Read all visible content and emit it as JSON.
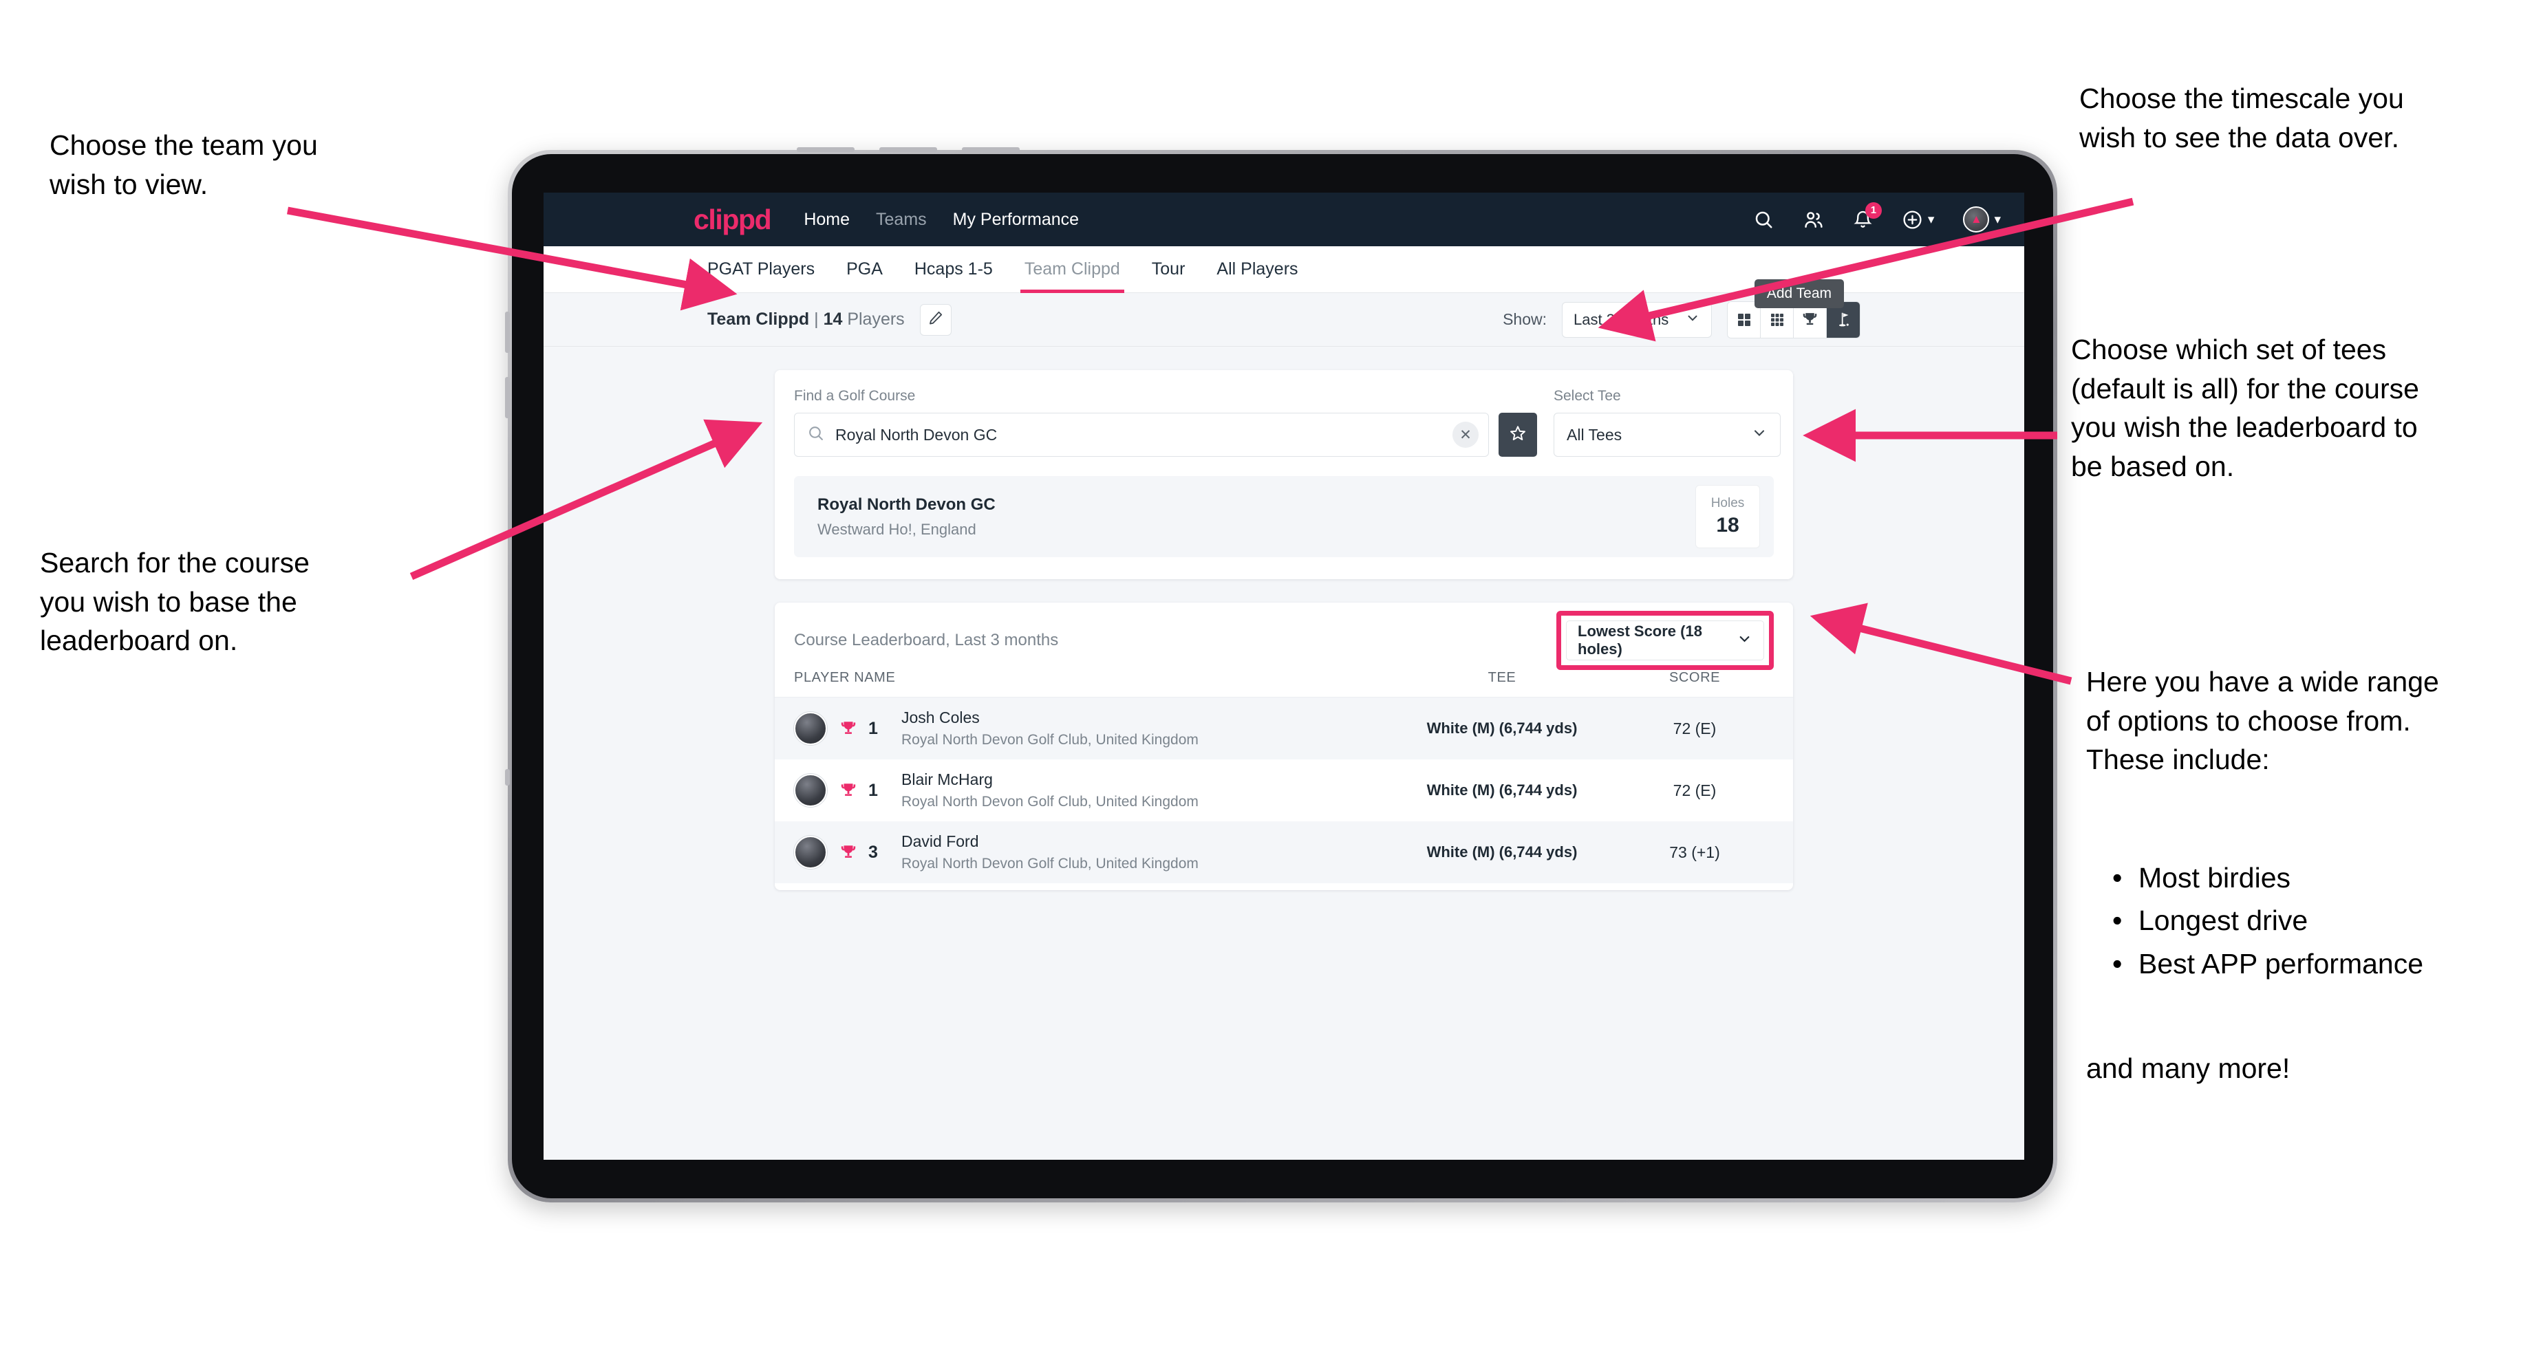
{
  "annotations": {
    "left_top": "Choose the team you\nwish to view.",
    "left_bottom": "Search for the course\nyou wish to base the\nleaderboard on.",
    "right_top": "Choose the timescale you\nwish to see the data over.",
    "right_mid": "Choose which set of tees\n(default is all) for the course\nyou wish the leaderboard to\nbe based on.",
    "right_bottom_intro": "Here you have a wide range\nof options to choose from.\nThese include:",
    "right_bottom_bullets": [
      "Most birdies",
      "Longest drive",
      "Best APP performance"
    ],
    "right_bottom_tail": "and many more!"
  },
  "app": {
    "brand": "clippd",
    "nav": [
      {
        "label": "Home",
        "active": true
      },
      {
        "label": "Teams",
        "active": false
      },
      {
        "label": "My Performance",
        "active": true
      }
    ],
    "header_icons": {
      "search": "search-icon",
      "people": "people-icon",
      "notifications": "bell-icon",
      "notification_count": "1",
      "add": "plus-circle-icon",
      "profile": "avatar-icon"
    },
    "tabs": [
      {
        "label": "PGAT Players",
        "active": false,
        "muted": false
      },
      {
        "label": "PGA",
        "active": false,
        "muted": false
      },
      {
        "label": "Hcaps 1-5",
        "active": false,
        "muted": false
      },
      {
        "label": "Team Clippd",
        "active": true,
        "muted": true
      },
      {
        "label": "Tour",
        "active": false,
        "muted": false
      },
      {
        "label": "All Players",
        "active": false,
        "muted": false
      }
    ],
    "tooltip": "Add Team"
  },
  "subbar": {
    "team_name": "Team Clippd",
    "separator": " | ",
    "player_count": "14",
    "players_word": " Players",
    "edit_icon": "pencil-icon",
    "show_label": "Show:",
    "timescale_value": "Last 3 months",
    "view_toggles": [
      {
        "icon": "grid-2x2-icon",
        "active": false
      },
      {
        "icon": "grid-3x3-icon",
        "active": false
      },
      {
        "icon": "trophy-icon",
        "active": false
      },
      {
        "icon": "golf-flag-icon",
        "active": true
      }
    ]
  },
  "search_card": {
    "course_field_label": "Find a Golf Course",
    "course_value": "Royal North Devon GC",
    "course_placeholder": "Find a Golf Course",
    "clear_icon": "close-icon",
    "favourite_icon": "star-icon",
    "tee_field_label": "Select Tee",
    "tee_value": "All Tees"
  },
  "course_result": {
    "name": "Royal North Devon GC",
    "location": "Westward Ho!, England",
    "holes_label": "Holes",
    "holes_value": "18"
  },
  "leaderboard": {
    "title": "Course Leaderboard,",
    "subtitle": " Last 3 months",
    "sort_value": "Lowest Score (18 holes)",
    "columns": [
      "PLAYER NAME",
      "TEE",
      "SCORE"
    ],
    "rows": [
      {
        "rank": "1",
        "name": "Josh Coles",
        "club": "Royal North Devon Golf Club, United Kingdom",
        "tee": "White (M) (6,744 yds)",
        "score": "72 (E)"
      },
      {
        "rank": "1",
        "name": "Blair McHarg",
        "club": "Royal North Devon Golf Club, United Kingdom",
        "tee": "White (M) (6,744 yds)",
        "score": "72 (E)"
      },
      {
        "rank": "3",
        "name": "David Ford",
        "club": "Royal North Devon Golf Club, United Kingdom",
        "tee": "White (M) (6,744 yds)",
        "score": "73 (+1)"
      }
    ]
  },
  "colors": {
    "accent_pink": "#ec2b6b",
    "header_dark": "#152230",
    "page_bg": "#f4f6f9",
    "toggle_active": "#3e4751"
  }
}
